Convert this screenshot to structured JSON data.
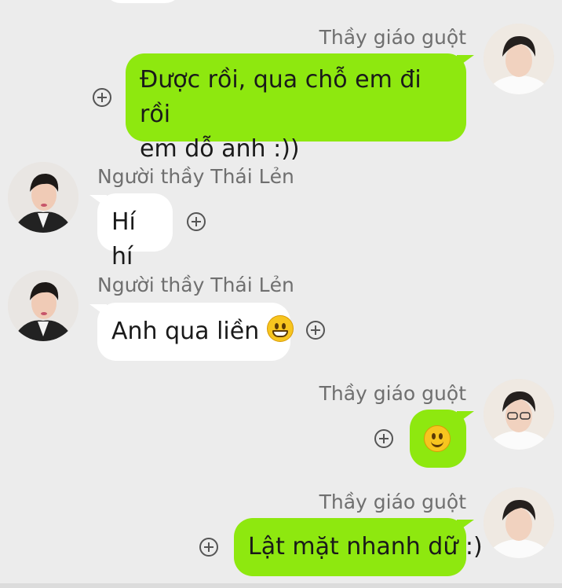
{
  "colors": {
    "background": "#ececec",
    "outgoing_bubble": "#8ee80f",
    "incoming_bubble": "#ffffff",
    "name_text": "#6f6f6f"
  },
  "messages": [
    {
      "direction": "outgoing",
      "sender": "Thầy giáo guột",
      "lines": [
        "Được rồi, qua chỗ em đi rồi",
        "em dỗ anh :))"
      ]
    },
    {
      "direction": "incoming",
      "sender": "Người thầy Thái Lẻn",
      "text": "Hí hí"
    },
    {
      "direction": "incoming",
      "sender": "Người thầy Thái Lẻn",
      "text": "Anh qua liền",
      "emoji": "grinning-face-emoji"
    },
    {
      "direction": "outgoing",
      "sender": "Thầy giáo guột",
      "emoji": "slightly-smiling-face-emoji"
    },
    {
      "direction": "outgoing",
      "sender": "Thầy giáo guột",
      "text": "Lật mặt nhanh dữ :)"
    }
  ]
}
